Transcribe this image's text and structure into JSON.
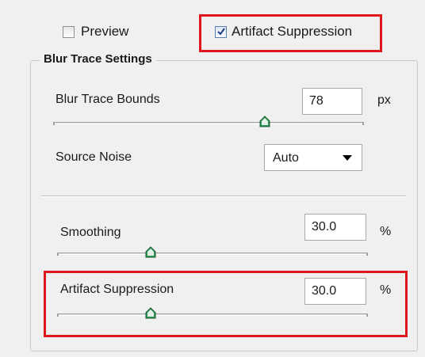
{
  "top_options": {
    "preview": {
      "label": "Preview",
      "checked": false
    },
    "artifact_suppression": {
      "label": "Artifact Suppression",
      "checked": true
    }
  },
  "blur_trace": {
    "title": "Blur Trace Settings",
    "bounds": {
      "label": "Blur Trace Bounds",
      "value": "78",
      "unit": "px",
      "slider_fraction": 0.68
    },
    "source_noise": {
      "label": "Source Noise",
      "selected": "Auto"
    }
  },
  "smoothing": {
    "label": "Smoothing",
    "value": "30.0",
    "unit": "%",
    "slider_fraction": 0.3
  },
  "artifact": {
    "label": "Artifact Suppression",
    "value": "30.0",
    "unit": "%",
    "slider_fraction": 0.3
  },
  "colors": {
    "highlight": "#e0161f",
    "thumb": "#2e9a57"
  }
}
